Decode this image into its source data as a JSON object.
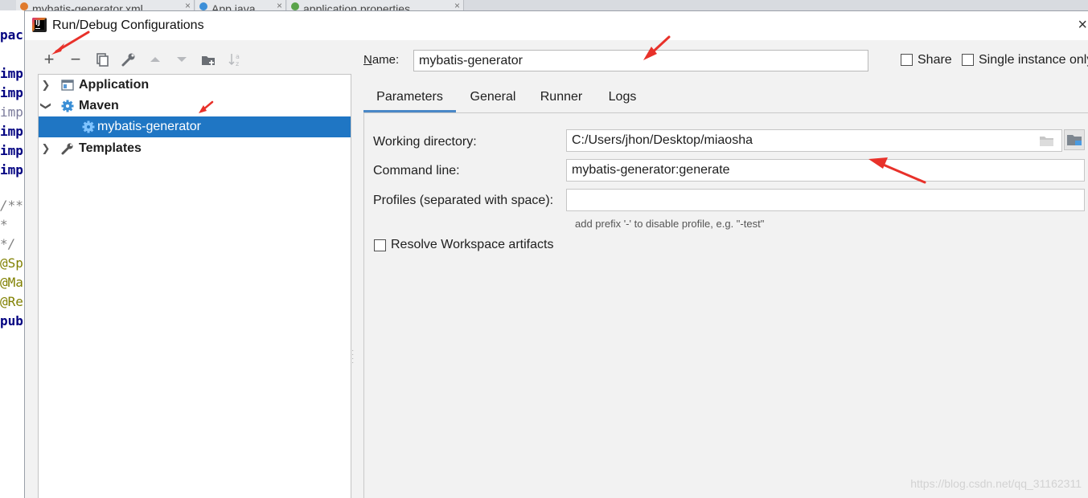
{
  "editor": {
    "tabs": [
      {
        "label": "mybatis-generator.xml",
        "color": "#e07a2c"
      },
      {
        "label": "App.java",
        "color": "#3c8fd8"
      },
      {
        "label": "application.properties",
        "color": "#5aa34a"
      }
    ],
    "gutter_lines": [
      "pac",
      "",
      "imp",
      "imp",
      "imp",
      "imp",
      "imp",
      "imp",
      "",
      "/**",
      " *",
      " */",
      "@Sp",
      "@Ma",
      "@Re",
      "pub"
    ]
  },
  "dialog": {
    "title": "Run/Debug Configurations",
    "close_symbol": "×",
    "app_icon_text": "IJ"
  },
  "toolbar": {
    "add": "+",
    "remove": "−",
    "copy": "copy",
    "edit": "edit",
    "move_up": "up",
    "move_down": "down",
    "new_folder": "folder",
    "sort": "sort"
  },
  "tree": {
    "items": [
      {
        "label": "Application",
        "icon": "application-icon"
      },
      {
        "label": "Maven",
        "icon": "maven-gear-icon"
      },
      {
        "label": "mybatis-generator",
        "icon": "maven-gear-icon"
      },
      {
        "label": "Templates",
        "icon": "wrench-icon"
      }
    ]
  },
  "form": {
    "name_label": "Name:",
    "name_value": "mybatis-generator",
    "share_label": "Share",
    "single_instance_label": "Single instance only",
    "tabs": [
      "Parameters",
      "General",
      "Runner",
      "Logs"
    ],
    "working_dir_label": "Working directory:",
    "working_dir_value": "C:/Users/jhon/Desktop/miaosha",
    "command_line_label": "Command line:",
    "command_line_value": "mybatis-generator:generate",
    "profiles_label": "Profiles (separated with space):",
    "profiles_value": "",
    "profiles_hint": "add prefix '-' to disable profile, e.g. \"-test\"",
    "resolve_label": "Resolve Workspace artifacts"
  },
  "watermark": "https://blog.csdn.net/qq_31162311",
  "colors": {
    "selection": "#1f76c4",
    "tab_underline": "#4a88c7",
    "annotation_arrow": "#e8312a"
  }
}
